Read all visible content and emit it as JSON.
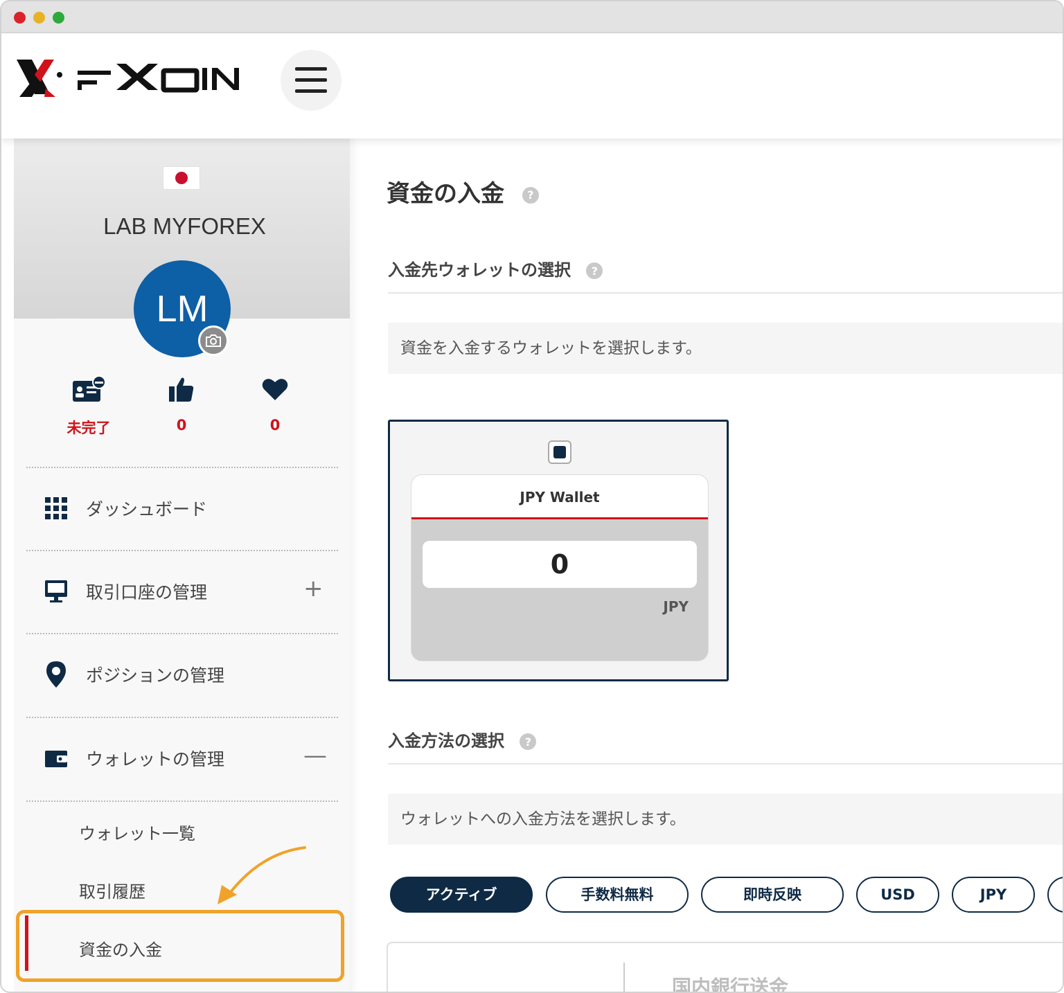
{
  "window": {
    "controls": [
      "close",
      "minimize",
      "zoom"
    ]
  },
  "header": {
    "logo_text": "FXON",
    "menu_icon": "hamburger-icon"
  },
  "sidebar": {
    "country_flag": "Japan",
    "username": "LAB MYFOREX",
    "avatar_initials": "LM",
    "stats": [
      {
        "icon": "id-card-icon",
        "value": "未完了"
      },
      {
        "icon": "thumbs-up-icon",
        "value": "0"
      },
      {
        "icon": "heart-icon",
        "value": "0"
      }
    ],
    "nav": [
      {
        "icon": "grid-icon",
        "label": "ダッシュボード",
        "toggle": ""
      },
      {
        "icon": "monitor-icon",
        "label": "取引口座の管理",
        "toggle": "+"
      },
      {
        "icon": "map-pin-icon",
        "label": "ポジションの管理",
        "toggle": ""
      },
      {
        "icon": "wallet-icon",
        "label": "ウォレットの管理",
        "toggle": "—"
      }
    ],
    "wallet_submenu": [
      {
        "label": "ウォレット一覧"
      },
      {
        "label": "取引履歴"
      },
      {
        "label": "資金の入金",
        "active": true
      }
    ]
  },
  "main": {
    "page_title": "資金の入金",
    "wallet_section": {
      "title": "入金先ウォレットの選択",
      "description": "資金を入金するウォレットを選択します。",
      "wallet": {
        "name": "JPY Wallet",
        "balance": "0",
        "currency": "JPY",
        "selected": true
      }
    },
    "method_section": {
      "title": "入金方法の選択",
      "description": "ウォレットへの入金方法を選択します。",
      "filters": [
        {
          "label": "アクティブ",
          "active": true
        },
        {
          "label": "手数料無料",
          "active": false
        },
        {
          "label": "即時反映",
          "active": false
        },
        {
          "label": "USD",
          "active": false
        },
        {
          "label": "JPY",
          "active": false
        }
      ],
      "first_method": "国内銀行送金"
    }
  },
  "colors": {
    "brand_red": "#d0121b",
    "navy": "#0f2a45",
    "avatar_blue": "#0d5fa6",
    "highlight_orange": "#f0a22a"
  }
}
